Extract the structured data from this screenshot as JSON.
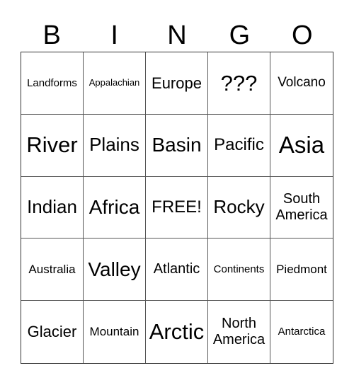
{
  "header": {
    "letters": [
      "B",
      "I",
      "N",
      "G",
      "O"
    ]
  },
  "card": {
    "rows": [
      [
        "Landforms",
        "Appalachian",
        "Europe",
        "???",
        "Volcano"
      ],
      [
        "River",
        "Plains",
        "Basin",
        "Pacific",
        "Asia"
      ],
      [
        "Indian",
        "Africa",
        "FREE!",
        "Rocky",
        "South America"
      ],
      [
        "Australia",
        "Valley",
        "Atlantic",
        "Continents",
        "Piedmont"
      ],
      [
        "Glacier",
        "Mountain",
        "Arctic",
        "North America",
        "Antarctica"
      ]
    ]
  }
}
